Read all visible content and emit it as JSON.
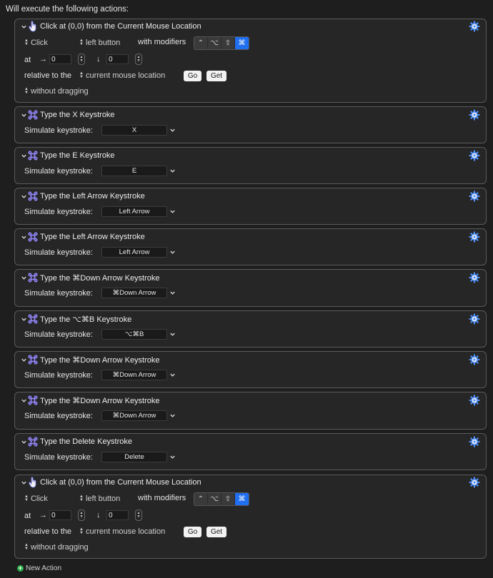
{
  "header": "Will execute the following actions:",
  "simulate_label": "Simulate keystroke:",
  "click_actions": [
    {
      "title": "Click at (0,0) from the Current Mouse Location",
      "click_popup": "Click",
      "button_popup": "left button",
      "with_modifiers": "with modifiers",
      "modifiers": [
        "⌃",
        "⌥",
        "⇧",
        "⌘"
      ],
      "at_label": "at",
      "x_arrow": "→",
      "x_value": "0",
      "y_arrow": "↓",
      "y_value": "0",
      "relative_label": "relative to the",
      "relative_popup": "current mouse location",
      "go": "Go",
      "get": "Get",
      "drag_popup": "without dragging"
    },
    {
      "title": "Click at (0,0) from the Current Mouse Location",
      "click_popup": "Click",
      "button_popup": "left button",
      "with_modifiers": "with modifiers",
      "modifiers": [
        "⌃",
        "⌥",
        "⇧",
        "⌘"
      ],
      "at_label": "at",
      "x_arrow": "→",
      "x_value": "0",
      "y_arrow": "↓",
      "y_value": "0",
      "relative_label": "relative to the",
      "relative_popup": "current mouse location",
      "go": "Go",
      "get": "Get",
      "drag_popup": "without dragging"
    }
  ],
  "keystroke_actions": [
    {
      "title": "Type the X Keystroke",
      "key": "X"
    },
    {
      "title": "Type the E Keystroke",
      "key": "E"
    },
    {
      "title": "Type the Left Arrow Keystroke",
      "key": "Left Arrow"
    },
    {
      "title": "Type the Left Arrow Keystroke",
      "key": "Left Arrow"
    },
    {
      "title": "Type the ⌘Down Arrow Keystroke",
      "key": "⌘Down Arrow"
    },
    {
      "title": "Type the ⌥⌘B Keystroke",
      "key": "⌥⌘B"
    },
    {
      "title": "Type the ⌘Down Arrow Keystroke",
      "key": "⌘Down Arrow"
    },
    {
      "title": "Type the ⌘Down Arrow Keystroke",
      "key": "⌘Down Arrow"
    },
    {
      "title": "Type the Delete Keystroke",
      "key": "Delete"
    }
  ],
  "new_action": "New Action",
  "colors": {
    "accent": "#1f6ff0",
    "gear": "#4f8ff7",
    "command_icon": "#8e83f2",
    "plus": "#2fb04b"
  }
}
